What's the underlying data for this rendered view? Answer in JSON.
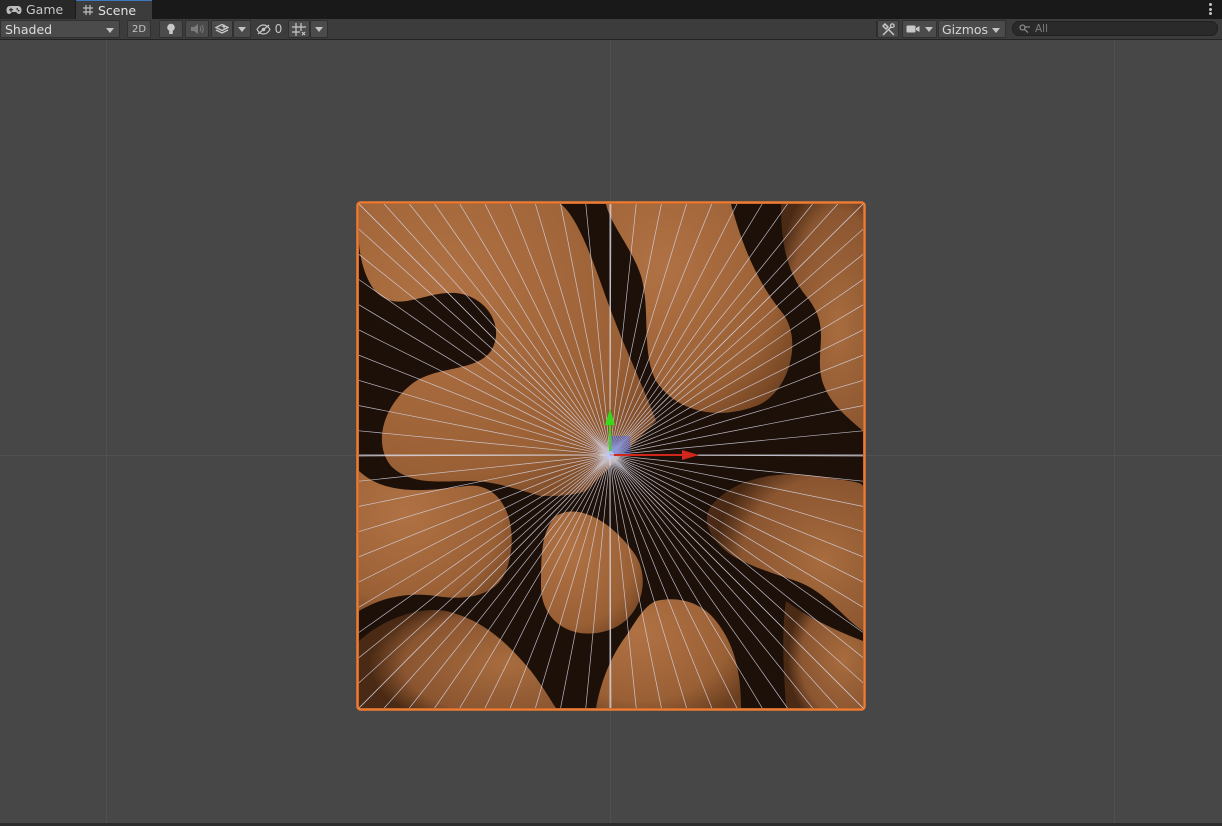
{
  "tabs": [
    {
      "label": "Game",
      "icon": "gamepad-icon",
      "active": false
    },
    {
      "label": "Scene",
      "icon": "grid-hash-icon",
      "active": true
    }
  ],
  "toolbar": {
    "draw_mode": "Shaded",
    "mode_2d_label": "2D",
    "hidden_objects_count": "0",
    "gizmos_label": "Gizmos",
    "search_placeholder": "All"
  },
  "icons": [
    "lighting-bulb-icon",
    "audio-speaker-icon",
    "effects-layers-icon",
    "visibility-eye-slash-icon",
    "grid-snap-icon",
    "tools-icon",
    "camera-icon",
    "search-magnifier-icon"
  ],
  "colors": {
    "selection_outline": "#f07a2e",
    "axis_x": "#d0261c",
    "axis_y": "#39d81c",
    "surface_light": "#a3673a",
    "surface_dark": "#1b0f07",
    "wire_lines": "#c8c8d8"
  }
}
